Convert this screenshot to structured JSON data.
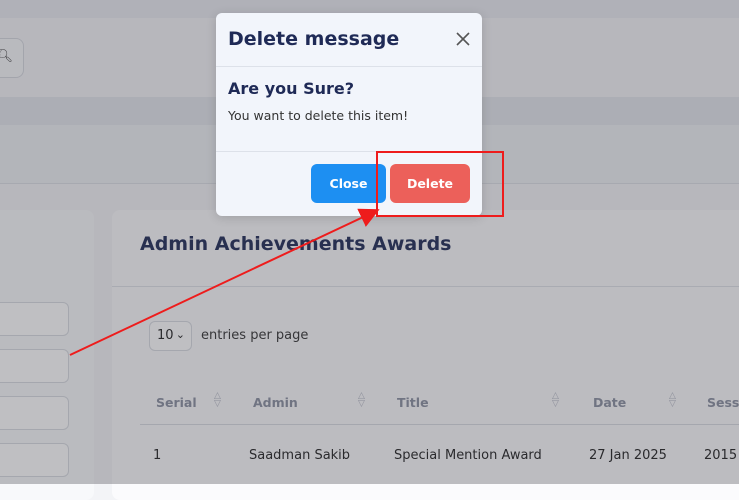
{
  "background": {
    "card_title": "Admin Achievements Awards",
    "entries_select_value": "10",
    "entries_label": "entries per page",
    "table": {
      "columns": [
        "Serial",
        "Admin",
        "Title",
        "Date",
        "Sess"
      ],
      "rows": [
        [
          "1",
          "Saadman Sakib",
          "Special Mention Award",
          "27 Jan 2025",
          "2015"
        ]
      ]
    }
  },
  "modal": {
    "title": "Delete message",
    "subtitle": "Are you Sure?",
    "message": "You want to delete this item!",
    "close_label": "Close",
    "delete_label": "Delete"
  },
  "colors": {
    "primary": "#1d8ff2",
    "danger": "#ec605a",
    "heading": "#1f2a56",
    "annotation": "#ee1c1c"
  },
  "icons": {
    "search": "search-icon",
    "close": "close-icon",
    "select_chevron": "chevron-down-icon",
    "sort": "sort-icon"
  }
}
